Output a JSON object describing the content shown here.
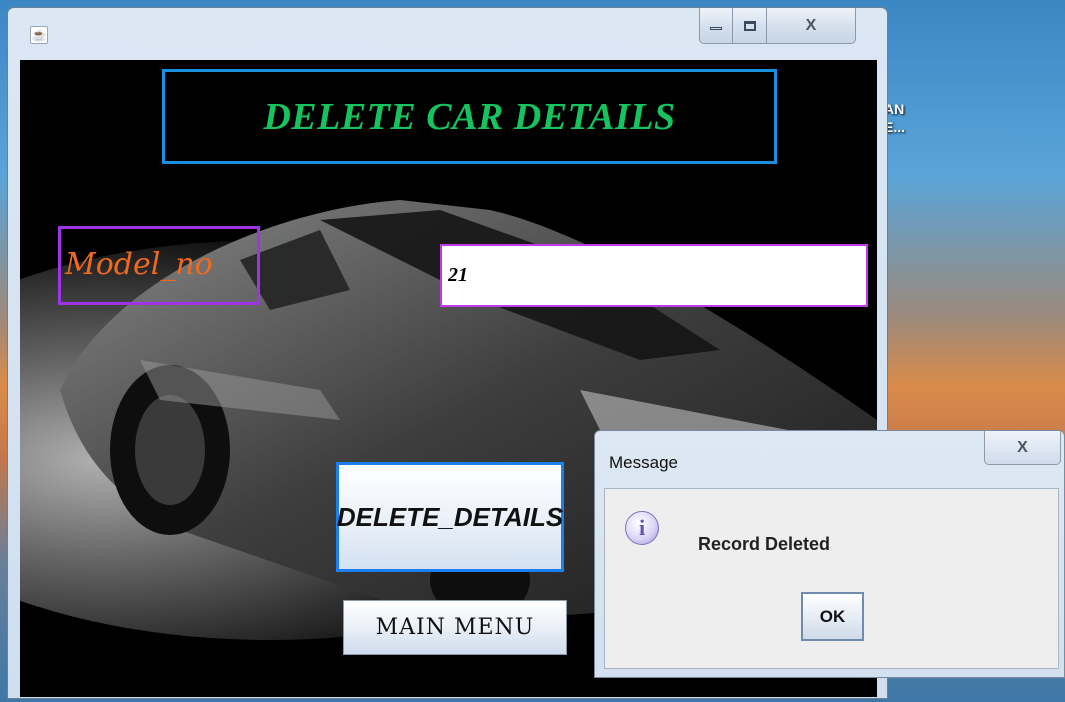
{
  "desktop": {
    "text_line1": "AN",
    "text_line2": "E..."
  },
  "window": {
    "icon": "java-icon",
    "controls": {
      "close_glyph": "X"
    }
  },
  "form": {
    "heading": "DELETE CAR DETAILS",
    "model_label": "Model_no",
    "model_value": "21",
    "delete_button": "DELETE_DETAILS",
    "main_menu_button": "MAIN MENU"
  },
  "dialog": {
    "title": "Message",
    "close_glyph": "X",
    "icon": "info-icon",
    "icon_glyph": "i",
    "message": "Record Deleted",
    "ok_button": "OK"
  },
  "colors": {
    "heading": "#15c45e",
    "heading_border": "#1a8fe0",
    "label_text": "#f06a1e",
    "label_border": "#9b35e6",
    "input_border": "#c23ae8",
    "delete_border": "#1b7fef"
  }
}
